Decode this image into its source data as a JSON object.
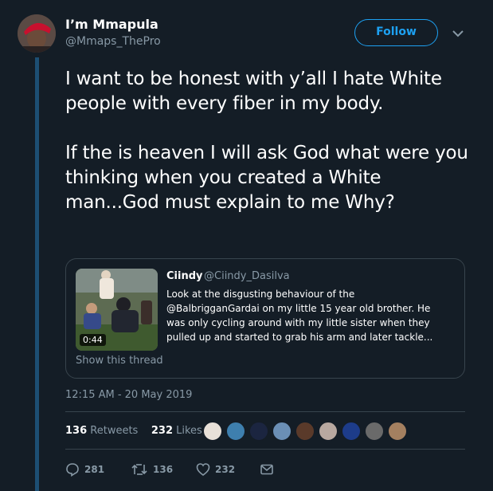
{
  "author": {
    "name": "I’m Mmapula",
    "handle": "@Mmaps_ThePro",
    "follow_label": "Follow"
  },
  "tweet": {
    "paragraphs": [
      "I want to be honest with y’all I hate White people with every fiber in my body.",
      "If the is heaven I will ask God what were you thinking when you created a White man...God must explain to me Why?"
    ],
    "timestamp": "12:15 AM - 20 May 2019"
  },
  "quote": {
    "name": "Ciindy",
    "handle": "@Ciindy_Dasilva",
    "lines": [
      "Look at the disgusting behaviour of the",
      "@BalbrigganGardai on my little 15 year old brother. He",
      "was only cycling around with my little sister when they",
      "pulled up and started to grab his arm and later tackle..."
    ],
    "video_duration": "0:44",
    "show_thread": "Show this thread"
  },
  "stats": {
    "retweets_count": "136",
    "retweets_label": "Retweets",
    "likes_count": "232",
    "likes_label": "Likes"
  },
  "actions": {
    "reply_count": "281",
    "retweet_count": "136",
    "like_count": "232"
  },
  "colors": {
    "background": "#141d26",
    "accent": "#1da1f2",
    "secondary_text": "#8899a6",
    "border": "#38444d",
    "thread_line": "#1d4f73"
  },
  "icons": [
    "chevron-down-icon",
    "reply-icon",
    "retweet-icon",
    "like-icon",
    "message-icon"
  ]
}
